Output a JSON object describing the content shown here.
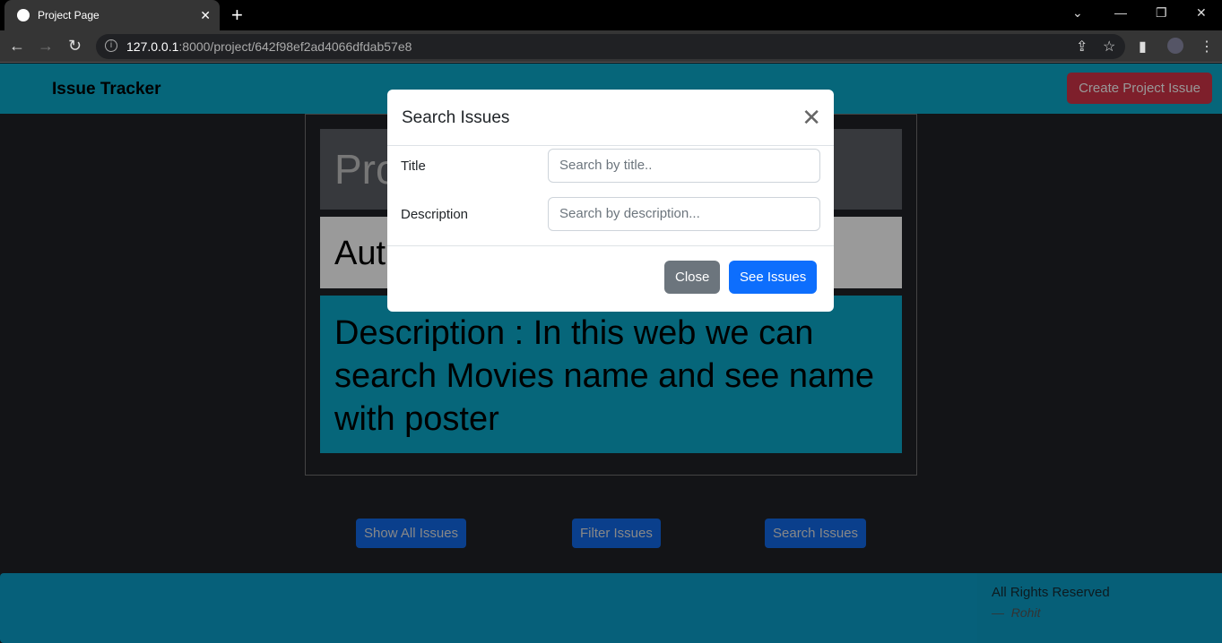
{
  "browser": {
    "tab_title": "Project Page",
    "url_host": "127.0.0.1",
    "url_path": ":8000/project/642f98ef2ad4066dfdab57e8"
  },
  "navbar": {
    "brand": "Issue Tracker",
    "create_button": "Create Project Issue"
  },
  "project": {
    "name_partial": "Pro",
    "author_partial": "Aut",
    "description": "Description : In this web we can search Movies name and see name with poster"
  },
  "actions": {
    "show_all": "Show All Issues",
    "filter": "Filter Issues",
    "search": "Search Issues"
  },
  "footer": {
    "rights": "All Rights Reserved",
    "author": "Rohit",
    "dash": "—"
  },
  "modal": {
    "title": "Search Issues",
    "title_label": "Title",
    "title_placeholder": "Search by title..",
    "description_label": "Description",
    "description_placeholder": "Search by description...",
    "close_button": "Close",
    "submit_button": "See Issues"
  }
}
